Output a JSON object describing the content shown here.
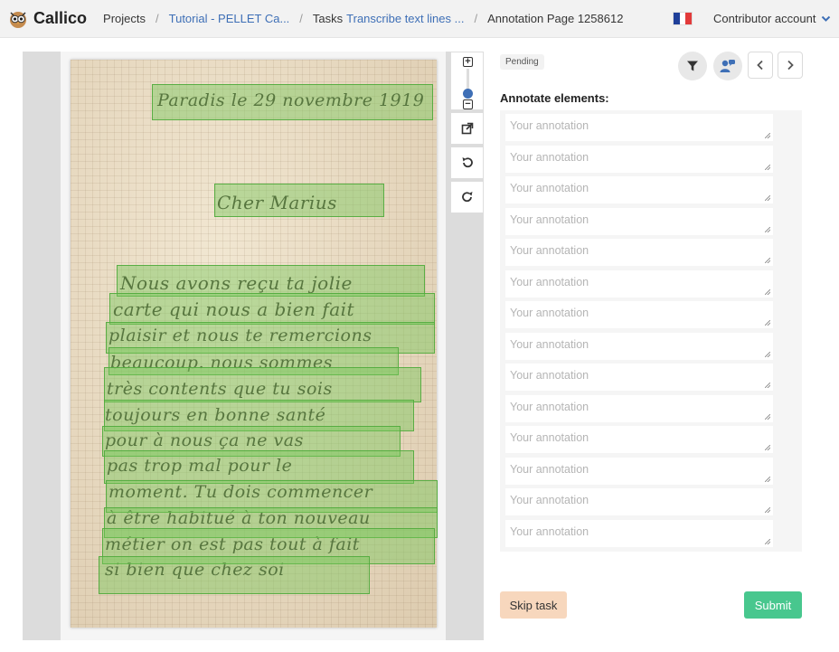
{
  "navbar": {
    "brand": "Callico",
    "breadcrumbs": [
      {
        "label": "Projects"
      },
      {
        "label": "Tutorial - PELLET Ca..."
      },
      {
        "prefix": "Tasks",
        "label": "Transcribe text lines ..."
      },
      {
        "label": "Annotation Page 1258612"
      }
    ],
    "language_flag": "french-flag-icon",
    "account_label": "Contributor account"
  },
  "document": {
    "lines": [
      "Paradis le 29 novembre 1919",
      "Cher Marius",
      "Nous avons reçu ta jolie",
      "carte qui nous a bien fait",
      "plaisir et nous te remercions",
      "beaucoup. nous sommes",
      "très contents que tu sois",
      "toujours en bonne santé",
      "pour à nous ça ne vas",
      "pas trop mal pour le",
      "moment. Tu dois commencer",
      "à être habitué à ton nouveau",
      "métier on est pas tout à fait",
      "si bien que chez soi"
    ]
  },
  "viewer_tools": {
    "zoom_in_icon": "plus-icon",
    "zoom_out_icon": "minus-icon",
    "open_icon": "external-link-icon",
    "rotate_left_icon": "rotate-left-icon",
    "rotate_right_icon": "rotate-right-icon"
  },
  "panel": {
    "status": "Pending",
    "heading": "Annotate elements:",
    "annotation_placeholder": "Your annotation",
    "annotation_count": 14,
    "skip_label": "Skip task",
    "submit_label": "Submit"
  },
  "colors": {
    "accent_link": "#3e6fb6",
    "zone_fill": "#78c85a",
    "submit": "#48c78e",
    "skip": "#f7d7bd"
  }
}
